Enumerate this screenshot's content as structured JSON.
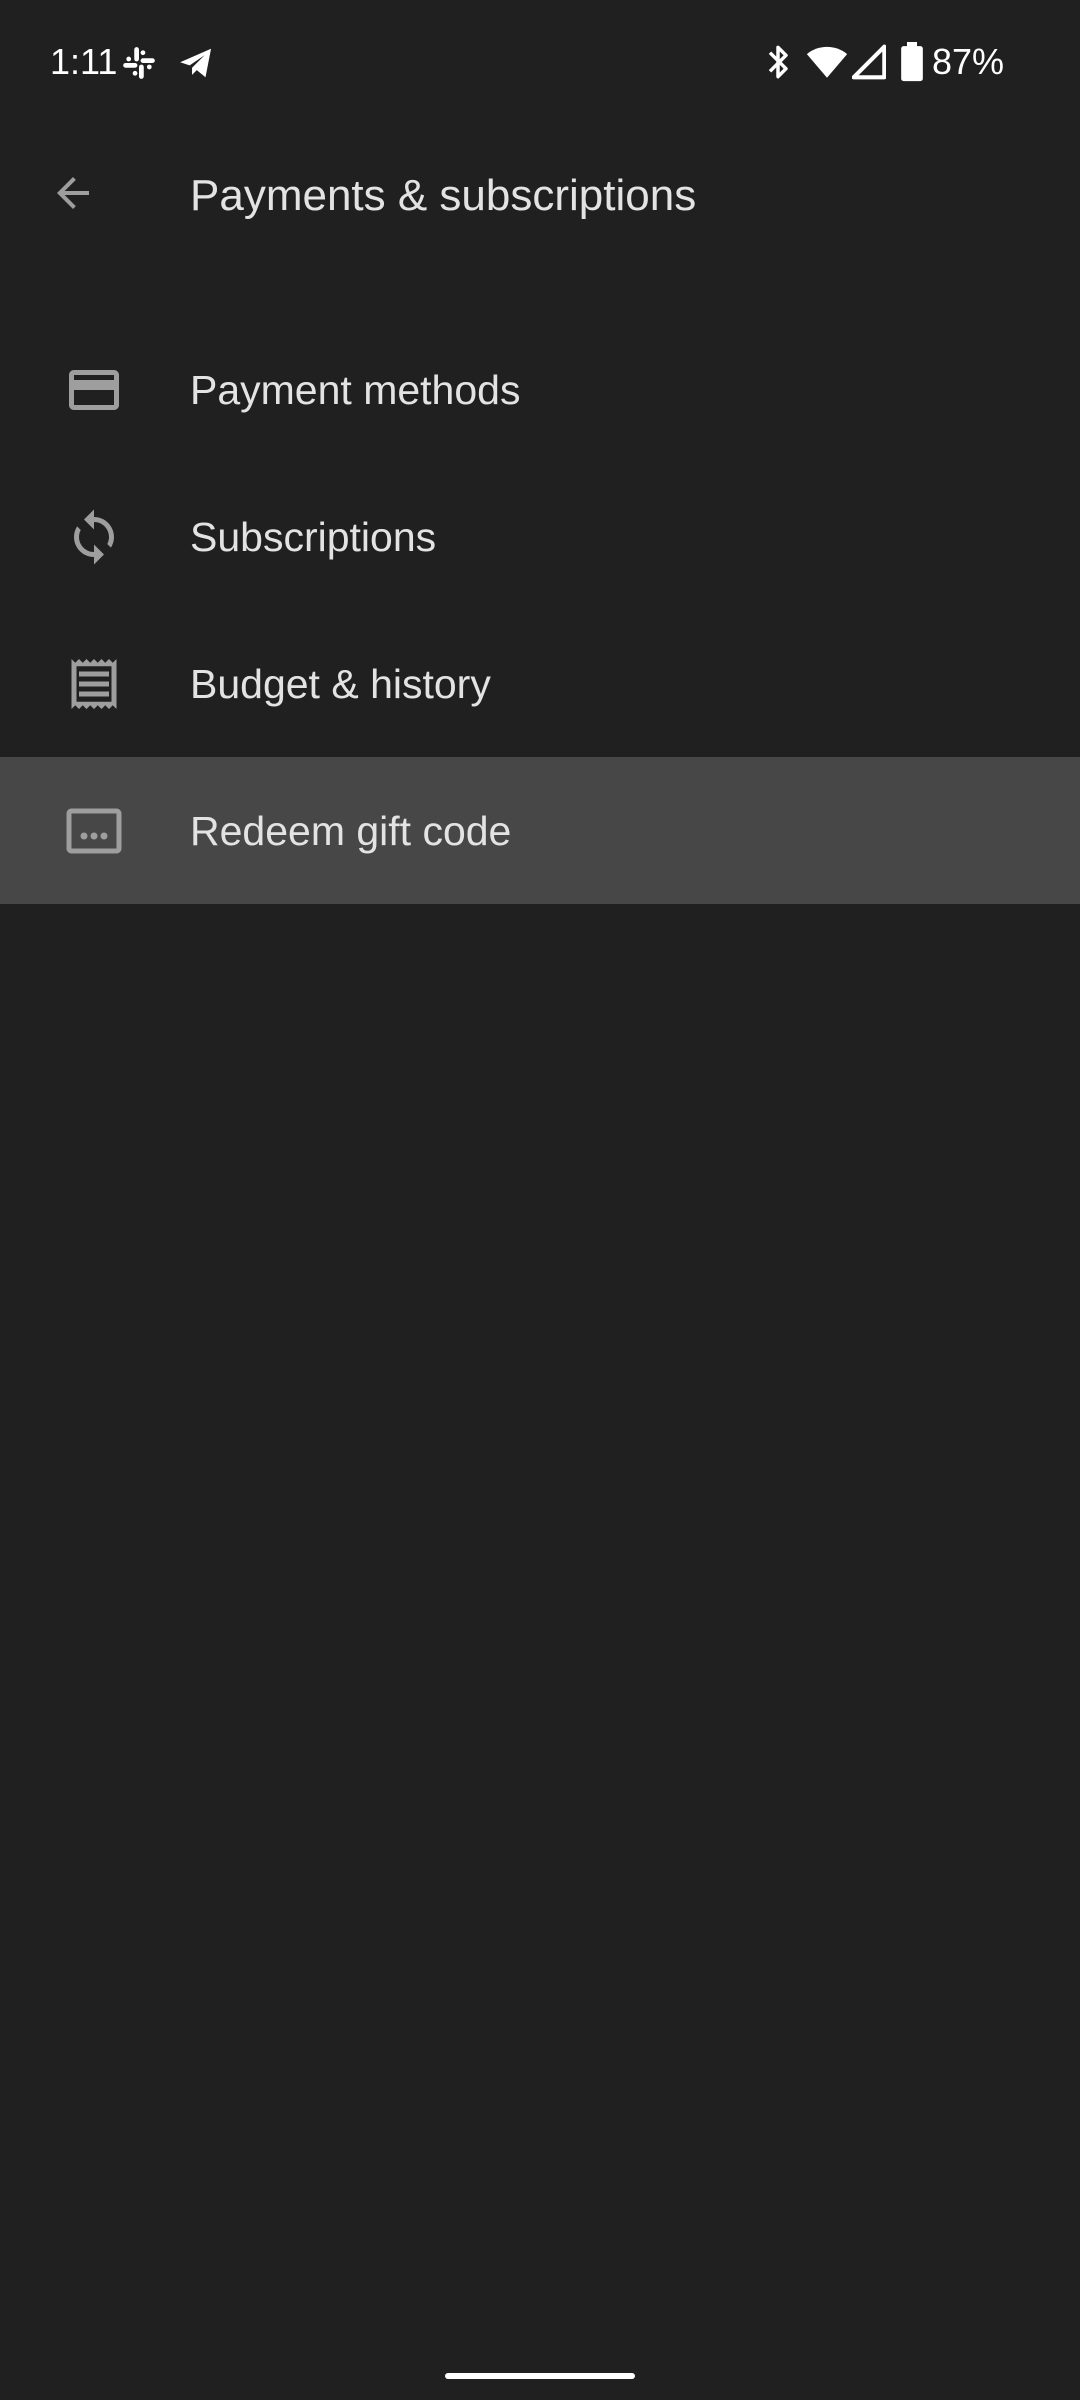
{
  "status_bar": {
    "time": "1:11",
    "battery_percent": "87%",
    "icons": [
      "slack-icon",
      "telegram-icon",
      "bluetooth-icon",
      "wifi-icon",
      "cell-signal-icon",
      "battery-icon"
    ]
  },
  "app_bar": {
    "title": "Payments & subscriptions",
    "back_icon": "arrow-back-icon"
  },
  "menu": {
    "items": [
      {
        "label": "Payment methods",
        "icon": "credit-card-icon",
        "highlighted": false
      },
      {
        "label": "Subscriptions",
        "icon": "sync-icon",
        "highlighted": false
      },
      {
        "label": "Budget & history",
        "icon": "receipt-icon",
        "highlighted": false
      },
      {
        "label": "Redeem gift code",
        "icon": "gift-code-icon",
        "highlighted": true
      }
    ]
  },
  "colors": {
    "background": "#202020",
    "highlight": "#474747",
    "text": "#e3e3e3",
    "icon": "#9e9e9e"
  }
}
